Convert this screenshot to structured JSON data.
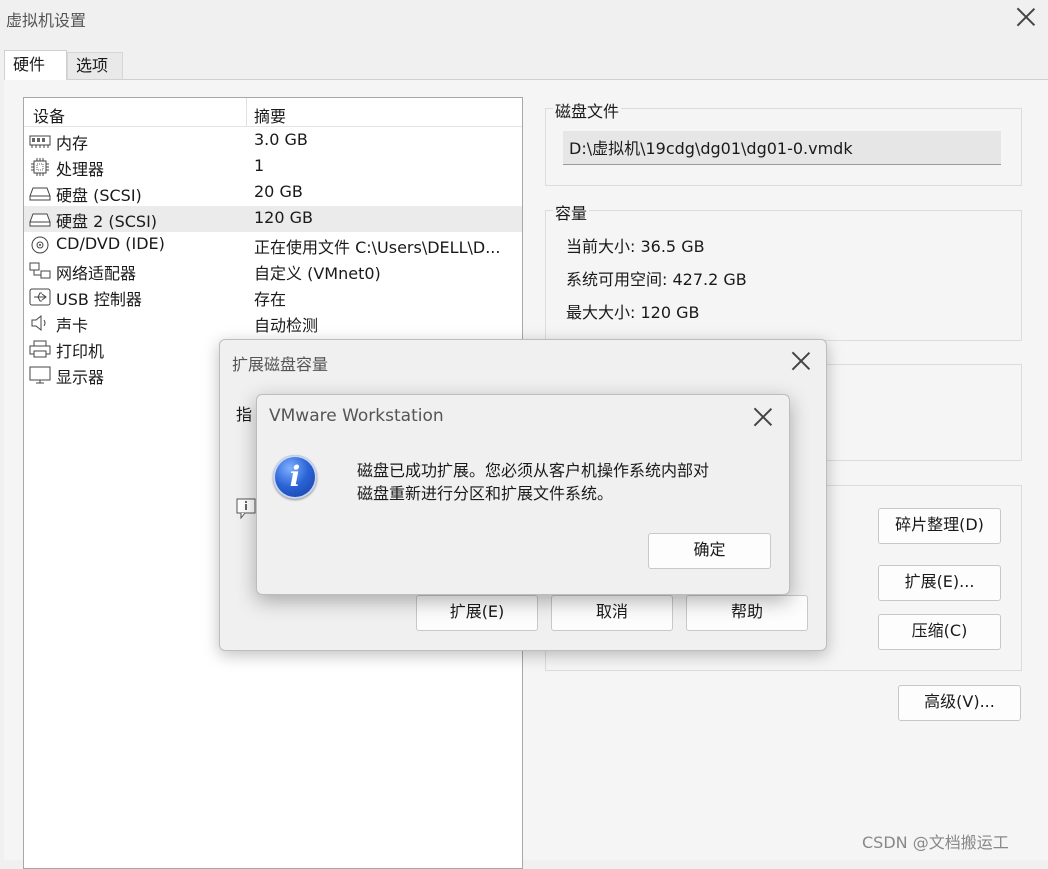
{
  "window": {
    "title": "虚拟机设置"
  },
  "tabs": [
    {
      "label": "硬件"
    },
    {
      "label": "选项"
    }
  ],
  "device_list": {
    "col_device": "设备",
    "col_summary": "摘要",
    "rows": [
      {
        "name": "内存",
        "summary": "3.0 GB",
        "icon": "memory-icon"
      },
      {
        "name": "处理器",
        "summary": "1",
        "icon": "cpu-icon"
      },
      {
        "name": "硬盘 (SCSI)",
        "summary": "20 GB",
        "icon": "harddisk-icon"
      },
      {
        "name": "硬盘 2 (SCSI)",
        "summary": "120 GB",
        "icon": "harddisk-icon"
      },
      {
        "name": "CD/DVD (IDE)",
        "summary": "正在使用文件 C:\\Users\\DELL\\D...",
        "icon": "cd-icon"
      },
      {
        "name": "网络适配器",
        "summary": "自定义 (VMnet0)",
        "icon": "network-icon"
      },
      {
        "name": "USB 控制器",
        "summary": "存在",
        "icon": "usb-icon"
      },
      {
        "name": "声卡",
        "summary": "自动检测",
        "icon": "speaker-icon"
      },
      {
        "name": "打印机",
        "summary": "",
        "icon": "printer-icon"
      },
      {
        "name": "显示器",
        "summary": "",
        "icon": "monitor-icon"
      }
    ]
  },
  "disk_file": {
    "label": "磁盘文件",
    "path": "D:\\虚拟机\\19cdg\\dg01\\dg01-0.vmdk"
  },
  "capacity": {
    "label": "容量",
    "current_size": "当前大小: 36.5 GB",
    "free_space": "系统可用空间: 427.2 GB",
    "max_size": "最大大小: 120 GB"
  },
  "utilities": {
    "partial_text": "。",
    "defrag": "碎片整理(D)",
    "expand": "扩展(E)...",
    "compact": "压缩(C)"
  },
  "advanced_button": "高级(V)...",
  "expand_dialog": {
    "title": "扩展磁盘容量",
    "partial_text": "指",
    "expand_button": "扩展(E)",
    "cancel_button": "取消",
    "help_button": "帮助"
  },
  "message_dialog": {
    "title": "VMware Workstation",
    "message_line1": "磁盘已成功扩展。您必须从客户机操作系统内部对",
    "message_line2": "磁盘重新进行分区和扩展文件系统。",
    "ok_button": "确定"
  },
  "watermark": "CSDN @文档搬运工"
}
